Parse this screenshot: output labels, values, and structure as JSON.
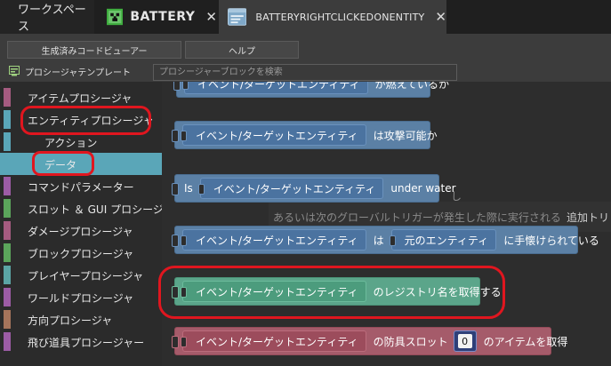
{
  "tabs": {
    "workspace": "ワークスペース",
    "battery": "BATTERY",
    "entity": "BATTERYRIGHTCLICKEDONENTITY",
    "close_glyph": "✕"
  },
  "toolbar": {
    "code_viewer": "生成済みコードビューアー",
    "help": "ヘルプ"
  },
  "palette": {
    "title": "プロシージャテンプレート",
    "search_placeholder": "プロシージャーブロックを検索"
  },
  "categories": [
    {
      "label": "アイテムプロシージャ",
      "color": "#5aa6b8"
    },
    {
      "label": "エンティティプロシージャ",
      "color": "#5aa6b8"
    },
    {
      "label": "アクション",
      "color": "#5aa6b8"
    },
    {
      "label": "データ",
      "color": "#5aa6b8",
      "selected": true
    },
    {
      "label": "コマンドパラメーター",
      "color": "#9c5ca5"
    },
    {
      "label": "スロット ＆ GUI プロシージャ",
      "color": "#5ba55b"
    },
    {
      "label": "ダメージプロシージャ",
      "color": "#a55b80"
    },
    {
      "label": "ブロックプロシージャ",
      "color": "#5ba55b"
    },
    {
      "label": "プレイヤープロシージャ",
      "color": "#5ba5a5"
    },
    {
      "label": "ワールドプロシージャ",
      "color": "#a5745b"
    },
    {
      "label": "方向プロシージャ",
      "color": "#a5745b"
    },
    {
      "label": "飛び道具プロシージャー",
      "color": "#9c5ca5"
    }
  ],
  "blocks": {
    "b0": {
      "slot": "イベント/ターゲットエンティティ",
      "text": "が燃えているか"
    },
    "b1": {
      "slot": "イベント/ターゲットエンティティ",
      "text": "は攻撃可能か"
    },
    "b2": {
      "prefix": "Is",
      "slot": "イベント/ターゲットエンティティ",
      "text": "under water"
    },
    "b3": {
      "slot": "イベント/ターゲットエンティティ",
      "mid": "は",
      "slot2": "元のエンティティ",
      "text": "に手懐けられている"
    },
    "b4": {
      "slot": "イベント/ターゲットエンティティ",
      "text": "のレジストリ名を取得する"
    },
    "b5": {
      "slot": "イベント/ターゲットエンティティ",
      "mid": "の防具スロット",
      "number": "0",
      "text": "のアイテムを取得"
    }
  },
  "ghost": {
    "line1": "し",
    "line2": "あるいは次のグローバルトリガーが発生した際に実行される",
    "line3": "追加トリ"
  },
  "colors": {
    "blue_block": "#5b80a5",
    "green_block": "#5ba58a",
    "red_block": "#a55b6a",
    "annotation_red": "#e0161f"
  },
  "icons": {
    "battery_tab": "creeper-face-icon",
    "entity_tab": "procedure-window-icon",
    "palette": "template-icon"
  }
}
